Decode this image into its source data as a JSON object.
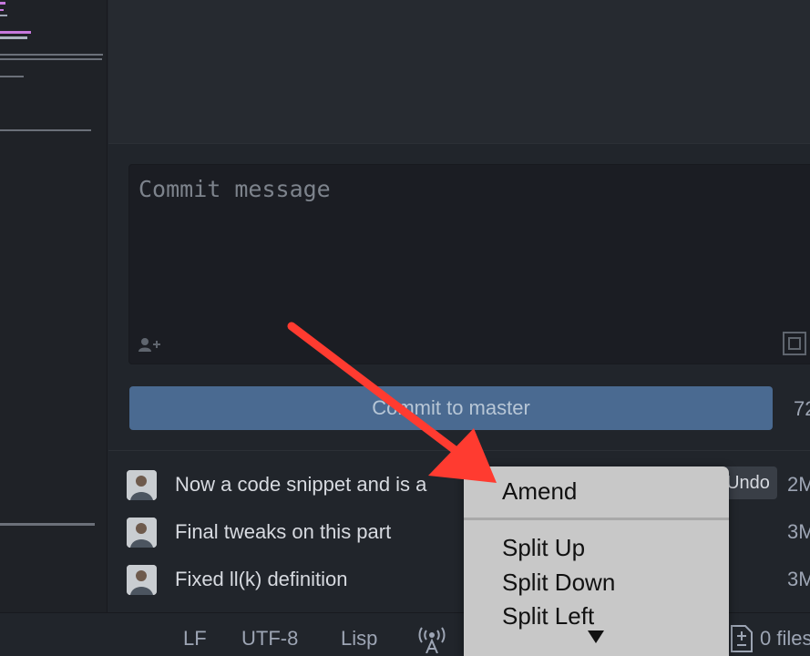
{
  "commit_panel": {
    "message_placeholder": "Commit message",
    "commit_button_label": "Commit to master",
    "commit_count": "72"
  },
  "recent_commits": [
    {
      "message": "Now a code snippet and is a",
      "time": "2M",
      "undo_label": "Undo"
    },
    {
      "message": "Final tweaks on this part",
      "time": "3M"
    },
    {
      "message": "Fixed ll(k) definition",
      "time": "3M"
    }
  ],
  "context_menu": {
    "items": [
      "Amend",
      "Split Up",
      "Split Down",
      "Split Left"
    ]
  },
  "status_bar": {
    "line_ending": "LF",
    "encoding": "UTF-8",
    "grammar": "Lisp",
    "files_label": "0 files"
  },
  "colors": {
    "commit_button": "#4a6a91",
    "annotation_arrow": "#ff3b30",
    "menu_background": "#c8c8c8"
  },
  "icons": [
    "coauthor-icon",
    "expand-icon",
    "avatar",
    "broadcast-icon",
    "file-diff-icon",
    "chevron-down-icon"
  ]
}
